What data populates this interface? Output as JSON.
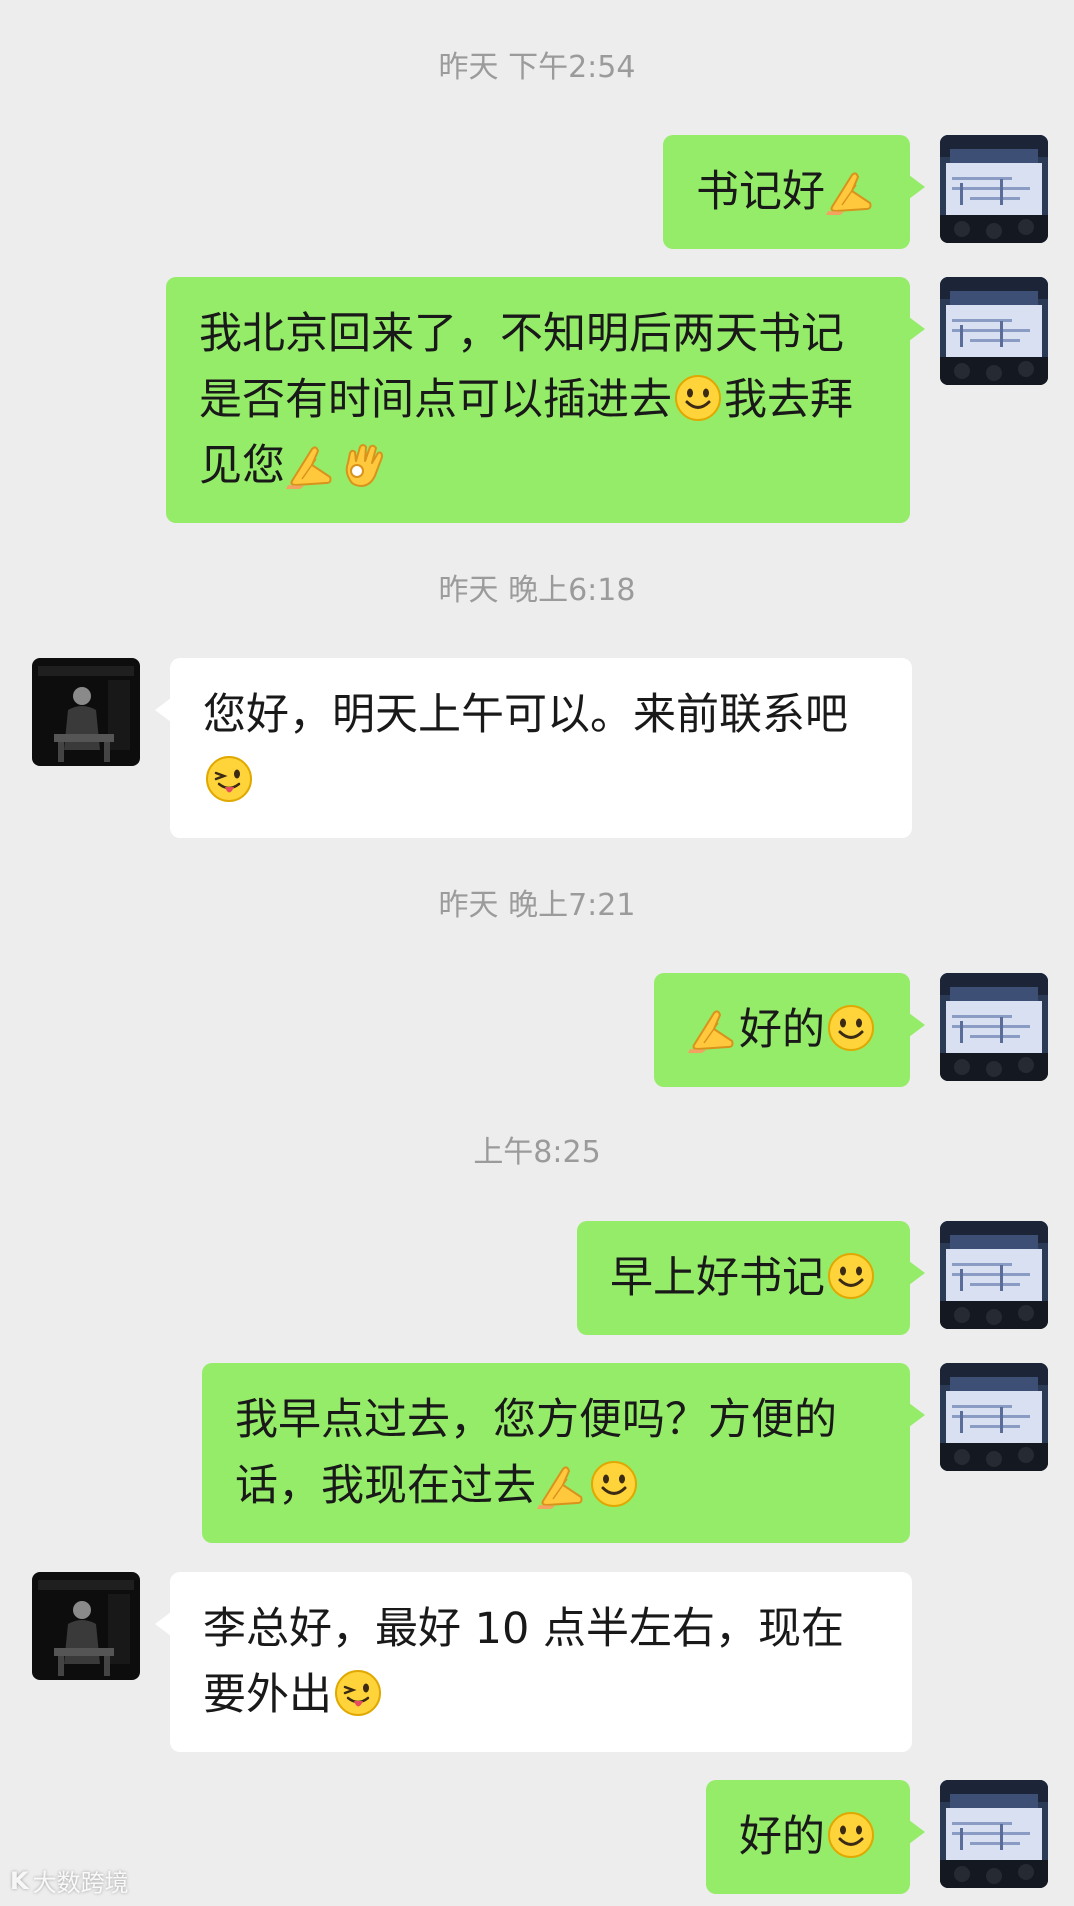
{
  "chat": {
    "timestamps": [
      "昨天 下午2:54",
      "昨天 晚上6:18",
      "昨天 晚上7:21",
      "上午8:25"
    ],
    "messages": [
      {
        "from": "me",
        "segments": [
          {
            "t": "书记好"
          },
          {
            "e": "pray-icon"
          }
        ]
      },
      {
        "from": "me",
        "segments": [
          {
            "t": "我北京回来了，不知明后两天书记是否有时间点可以插进去"
          },
          {
            "e": "smile-icon"
          },
          {
            "t": "我去拜见您"
          },
          {
            "e": "pray-icon"
          },
          {
            "e": "ok-hand-icon"
          }
        ]
      },
      {
        "from": "them",
        "segments": [
          {
            "t": "您好，明天上午可以。来前联系吧"
          },
          {
            "e": "wink-tongue-icon"
          }
        ]
      },
      {
        "from": "me",
        "segments": [
          {
            "e": "pray-icon"
          },
          {
            "t": "好的"
          },
          {
            "e": "smile-icon"
          }
        ]
      },
      {
        "from": "me",
        "segments": [
          {
            "t": "早上好书记"
          },
          {
            "e": "smile-icon"
          }
        ]
      },
      {
        "from": "me",
        "segments": [
          {
            "t": "我早点过去，您方便吗？方便的话，我现在过去"
          },
          {
            "e": "pray-icon"
          },
          {
            "e": "smile-icon"
          }
        ]
      },
      {
        "from": "them",
        "segments": [
          {
            "t": "李总好，最好 10 点半左右，现在要外出"
          },
          {
            "e": "wink-tongue-icon"
          }
        ]
      },
      {
        "from": "me",
        "segments": [
          {
            "t": "好的"
          },
          {
            "e": "smile-icon"
          }
        ]
      }
    ]
  },
  "watermark": {
    "logo": "K",
    "text": "大数跨境"
  },
  "colors": {
    "background": "#ededed",
    "outgoing_bubble": "#95ec69",
    "incoming_bubble": "#ffffff",
    "timestamp_text": "#9b9b9b"
  }
}
